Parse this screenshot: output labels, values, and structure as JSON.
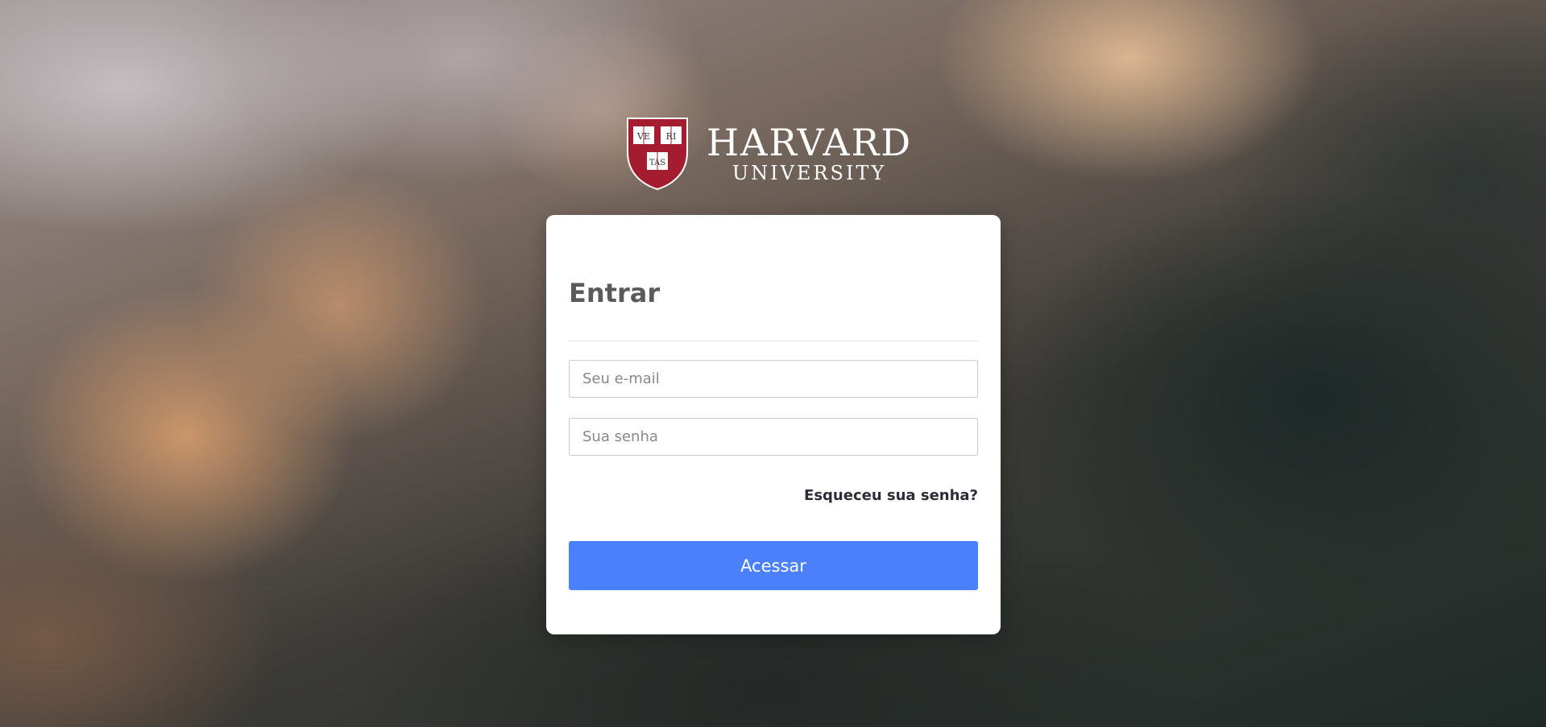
{
  "brand": {
    "name": "HARVARD",
    "subtitle": "UNIVERSITY",
    "shield_text": [
      "VE",
      "RI",
      "TAS"
    ],
    "shield_color": "#a51c30"
  },
  "login": {
    "title": "Entrar",
    "email_placeholder": "Seu e-mail",
    "email_value": "",
    "password_placeholder": "Sua senha",
    "password_value": "",
    "forgot_link": "Esqueceu sua senha?",
    "submit_label": "Acessar",
    "accent_color": "#4a80fb"
  }
}
